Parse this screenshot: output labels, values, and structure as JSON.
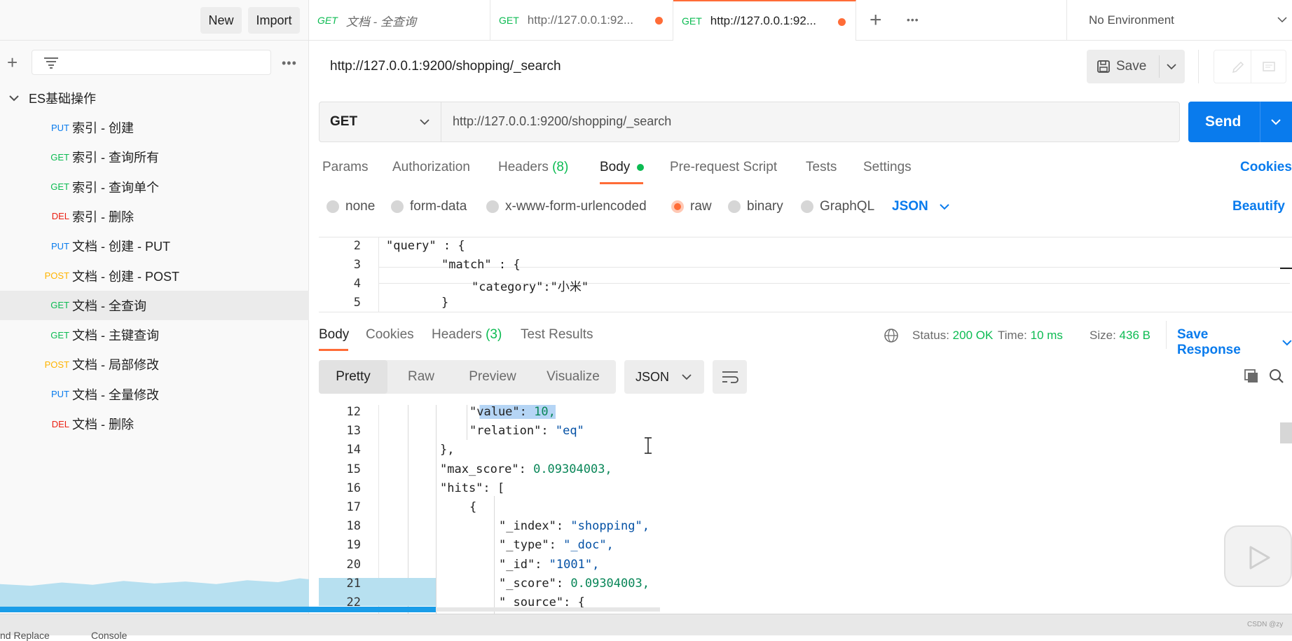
{
  "sidebar": {
    "new_label": "New",
    "import_label": "Import",
    "collection_name": "ES基础操作",
    "items": [
      {
        "method": "PUT",
        "label": "索引 - 创建"
      },
      {
        "method": "GET",
        "label": "索引 - 查询所有"
      },
      {
        "method": "GET",
        "label": "索引 - 查询单个"
      },
      {
        "method": "DEL",
        "label": "索引 - 删除"
      },
      {
        "method": "PUT",
        "label": "文档 - 创建 - PUT"
      },
      {
        "method": "POST",
        "label": "文档 - 创建 - POST"
      },
      {
        "method": "GET",
        "label": "文档 - 全查询"
      },
      {
        "method": "GET",
        "label": "文档 - 主键查询"
      },
      {
        "method": "POST",
        "label": "文档 - 局部修改"
      },
      {
        "method": "PUT",
        "label": "文档 - 全量修改"
      },
      {
        "method": "DEL",
        "label": "文档 - 删除"
      }
    ],
    "footer_left": "nd Replace",
    "footer_console": "Console"
  },
  "tabs": [
    {
      "method": "GET",
      "label": "文档 - 全查询"
    },
    {
      "method": "GET",
      "label": "http://127.0.0.1:92..."
    },
    {
      "method": "GET",
      "label": "http://127.0.0.1:92..."
    }
  ],
  "environment": "No Environment",
  "request": {
    "title": "http://127.0.0.1:9200/shopping/_search",
    "save_label": "Save",
    "method": "GET",
    "url": "http://127.0.0.1:9200/shopping/_search",
    "send_label": "Send"
  },
  "request_tabs": {
    "params": "Params",
    "authorization": "Authorization",
    "headers": "Headers",
    "headers_count": "(8)",
    "body": "Body",
    "pre_request": "Pre-request Script",
    "tests": "Tests",
    "settings": "Settings",
    "cookies": "Cookies"
  },
  "body_types": {
    "none": "none",
    "form_data": "form-data",
    "urlencoded": "x-www-form-urlencoded",
    "raw": "raw",
    "binary": "binary",
    "graphql": "GraphQL",
    "format": "JSON",
    "beautify": "Beautify"
  },
  "request_body": [
    {
      "line": "2",
      "text": "\"query\" : {"
    },
    {
      "line": "3",
      "text": "\"match\" : {"
    },
    {
      "line": "4",
      "text": "\"category\":\"小米\""
    },
    {
      "line": "5",
      "text": "}"
    }
  ],
  "response_tabs": {
    "body": "Body",
    "cookies": "Cookies",
    "headers": "Headers",
    "headers_count": "(3)",
    "test_results": "Test Results",
    "status_label": "Status:",
    "status_value": "200 OK",
    "time_label": "Time:",
    "time_value": "10 ms",
    "size_label": "Size:",
    "size_value": "436 B",
    "save_response": "Save Response"
  },
  "response_view": {
    "pretty": "Pretty",
    "raw": "Raw",
    "preview": "Preview",
    "visualize": "Visualize",
    "format": "JSON"
  },
  "response_lines": [
    {
      "line": "12",
      "key": "\"value\"",
      "value": "10,"
    },
    {
      "line": "13",
      "key": "\"relation\"",
      "value": "\"eq\""
    },
    {
      "line": "14",
      "key": "",
      "value": "},"
    },
    {
      "line": "15",
      "key": "\"max_score\"",
      "value": "0.09304003,"
    },
    {
      "line": "16",
      "key": "\"hits\"",
      "value": "["
    },
    {
      "line": "17",
      "key": "",
      "value": "{"
    },
    {
      "line": "18",
      "key": "\"_index\"",
      "value": "\"shopping\","
    },
    {
      "line": "19",
      "key": "\"_type\"",
      "value": "\"_doc\","
    },
    {
      "line": "20",
      "key": "\"_id\"",
      "value": "\"1001\","
    },
    {
      "line": "21",
      "key": "\"_score\"",
      "value": "0.09304003,"
    },
    {
      "line": "22",
      "key": "\"_source\"",
      "value": "{"
    }
  ],
  "watermark": "CSDN @zy",
  "colors": {
    "accent": "#ff6c37",
    "send": "#097bed",
    "get": "#0cbb52",
    "put": "#097bed",
    "post": "#ffb400",
    "del": "#eb2013",
    "status_ok": "#0cbb52"
  }
}
